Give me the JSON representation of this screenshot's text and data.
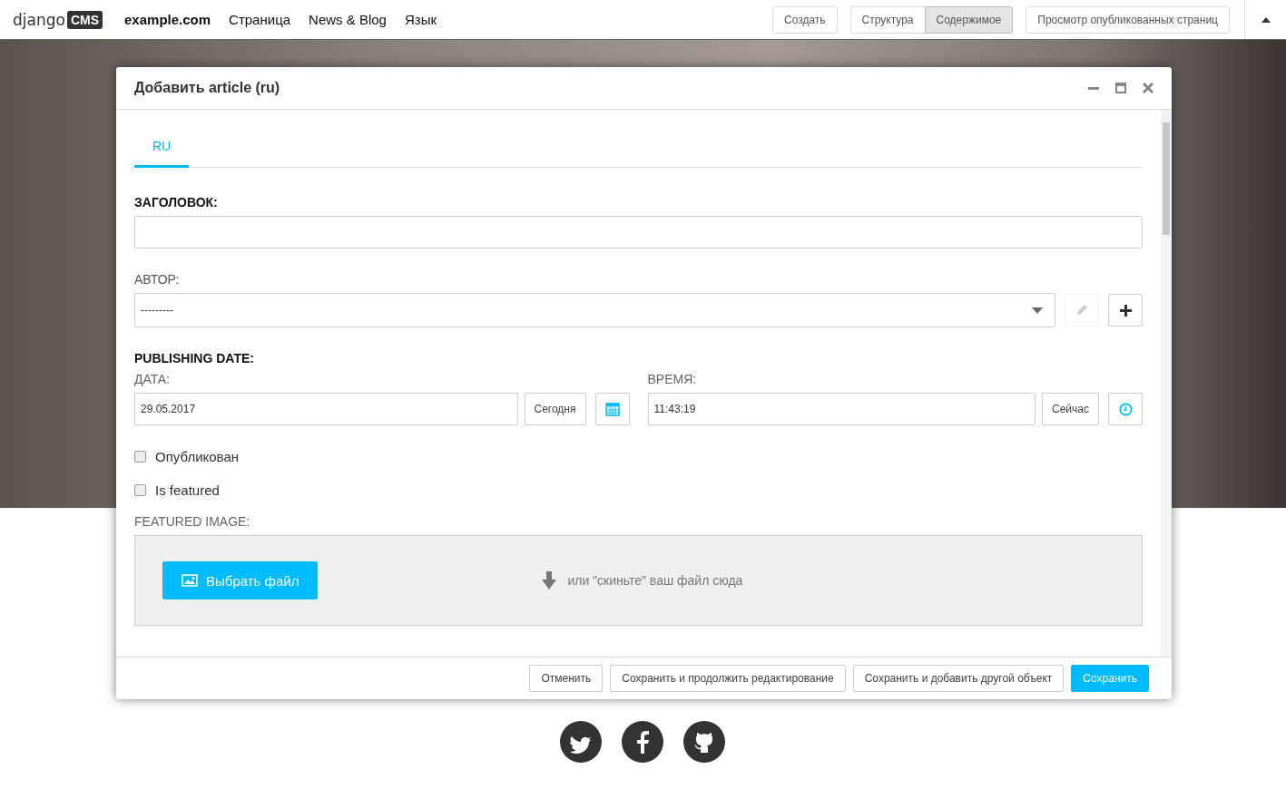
{
  "toolbar": {
    "logo": {
      "text": "django",
      "badge": "CMS"
    },
    "site": "example.com",
    "menu": [
      "Страница",
      "News & Blog",
      "Язык"
    ],
    "create": "Создать",
    "modes": [
      {
        "label": "Структура",
        "selected": false
      },
      {
        "label": "Содержимое",
        "selected": true
      }
    ],
    "view_published": "Просмотр опубликованных страниц"
  },
  "modal": {
    "title": "Добавить article (ru)",
    "tabs": [
      {
        "label": "RU",
        "selected": true
      }
    ],
    "title_field": {
      "label": "ЗАГОЛОВОК:"
    },
    "author": {
      "label": "АВТОР:",
      "value": "---------"
    },
    "publishing": {
      "label": "PUBLISHING DATE:",
      "date": {
        "label": "ДАТА:",
        "value": "29.05.2017",
        "button": "Сегодня"
      },
      "time": {
        "label": "ВРЕМЯ:",
        "value": "11:43:19",
        "button": "Сейчас"
      }
    },
    "checkboxes": [
      {
        "label": "Опубликован",
        "checked": false
      },
      {
        "label": "Is featured",
        "checked": false
      }
    ],
    "image": {
      "label": "FEATURED IMAGE:",
      "button": "Выбрать файл",
      "drop_hint": "или \"скиньте\" ваш файл сюда"
    },
    "buttons": [
      {
        "label": "Отменить",
        "kind": "default"
      },
      {
        "label": "Сохранить и продолжить редактирование",
        "kind": "default"
      },
      {
        "label": "Сохранить и добавить другой объект",
        "kind": "default"
      },
      {
        "label": "Сохранить",
        "kind": "primary"
      }
    ]
  }
}
